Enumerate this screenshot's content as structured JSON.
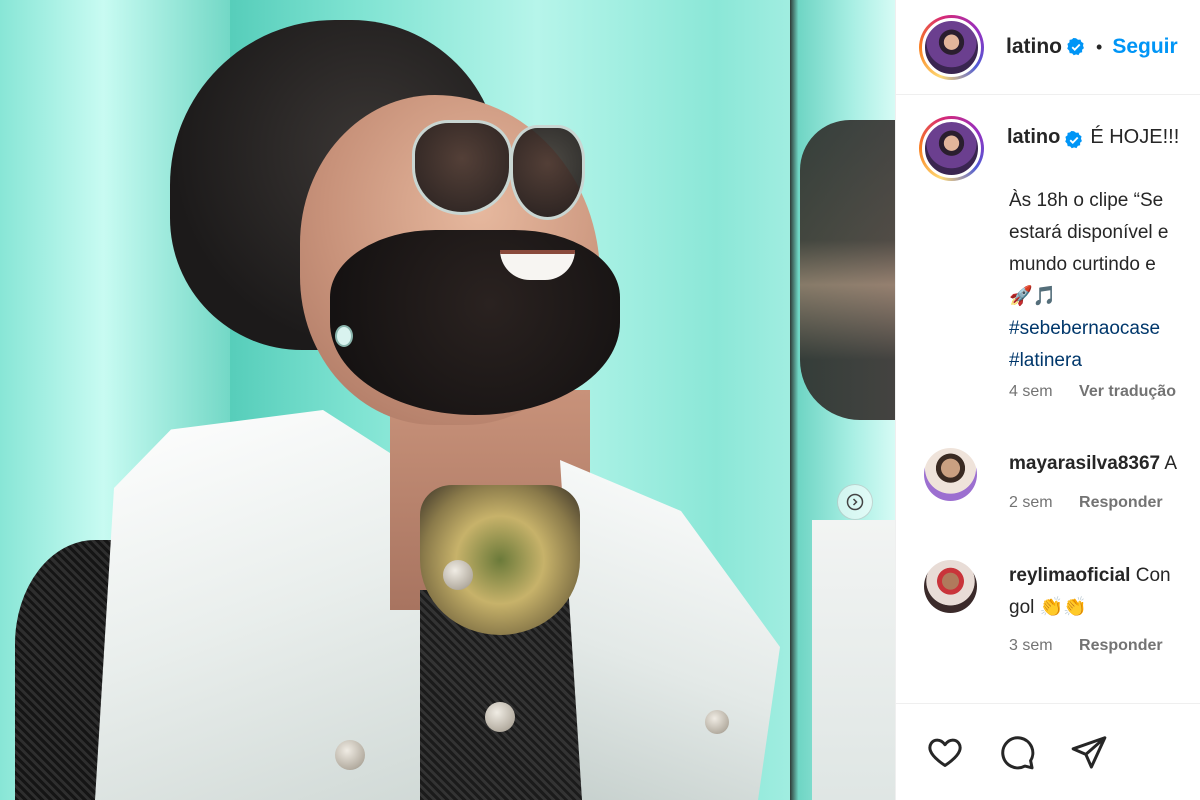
{
  "post": {
    "author": "latino",
    "separator": "•",
    "follow_label": "Seguir"
  },
  "caption": {
    "author": "latino",
    "first_line": "É HOJE!!!",
    "lines": [
      "Às 18h o clipe “Se",
      "estará disponível e",
      "mundo curtindo e",
      "🚀🎵"
    ],
    "hashtags": [
      "#sebebernaocase",
      "#latinera"
    ],
    "time": "4 sem",
    "translate_label": "Ver tradução"
  },
  "comments": [
    {
      "user": "mayarasilva8367",
      "text": "A",
      "continuation": "",
      "time": "2 sem",
      "reply_label": "Responder"
    },
    {
      "user": "reylimaoficial",
      "text": "Con",
      "continuation": "gol 👏👏",
      "time": "3 sem",
      "reply_label": "Responder"
    }
  ],
  "icons": {
    "like": "heart-icon",
    "comment": "comment-icon",
    "share": "share-icon",
    "verified": "verified-badge-icon",
    "carousel": "carousel-next-icon"
  },
  "colors": {
    "follow": "#0095f6",
    "hashtag": "#00376b",
    "verified": "#0095f6",
    "muted": "#737373"
  }
}
